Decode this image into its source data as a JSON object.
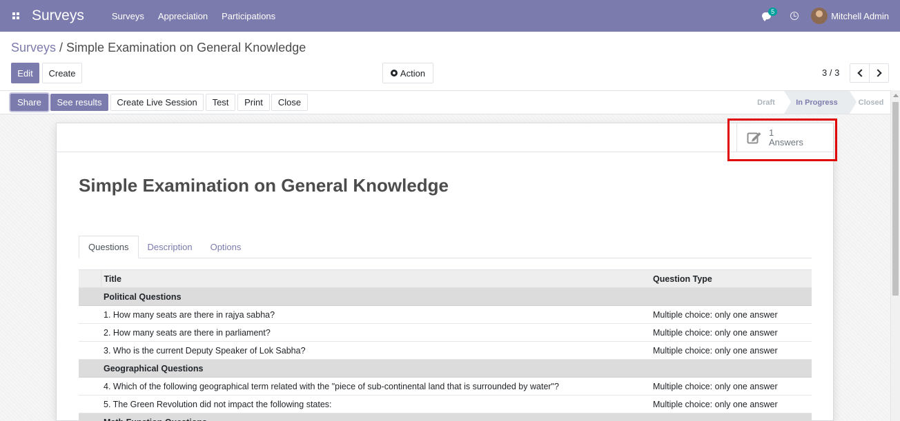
{
  "navbar": {
    "app_name": "Surveys",
    "menu": [
      "Surveys",
      "Appreciation",
      "Participations"
    ],
    "chat_count": "5",
    "user_name": "Mitchell Admin",
    "color": "#7c7bad"
  },
  "breadcrumb": {
    "parent": "Surveys",
    "separator": " / ",
    "current": "Simple Examination on General Knowledge"
  },
  "control_panel": {
    "edit_label": "Edit",
    "create_label": "Create",
    "action_label": "Action",
    "pager_value": "3 / 3"
  },
  "statusbar": {
    "buttons": [
      "Share",
      "See results",
      "Create Live Session",
      "Test",
      "Print",
      "Close"
    ],
    "stages": [
      "Draft",
      "In Progress",
      "Closed"
    ],
    "active_stage": "In Progress"
  },
  "sheet": {
    "stat_count": "1",
    "stat_label": "Answers",
    "title": "Simple Examination on General Knowledge",
    "tabs": [
      "Questions",
      "Description",
      "Options"
    ],
    "table": {
      "headers": [
        "Title",
        "Question Type"
      ],
      "rows": [
        {
          "kind": "section",
          "title": "Political Questions",
          "type": ""
        },
        {
          "kind": "question",
          "title": "1. How many seats are there in rajya sabha?",
          "type": "Multiple choice: only one answer"
        },
        {
          "kind": "question",
          "title": "2. How many seats are there in parliament?",
          "type": "Multiple choice: only one answer"
        },
        {
          "kind": "question",
          "title": "3. Who is the current Deputy Speaker of Lok Sabha?",
          "type": "Multiple choice: only one answer"
        },
        {
          "kind": "section",
          "title": "Geographical Questions",
          "type": ""
        },
        {
          "kind": "question",
          "title": "4. Which of the following geographical term related with the \"piece of sub-continental land that is surrounded by water\"?",
          "type": "Multiple choice: only one answer"
        },
        {
          "kind": "question",
          "title": "5. The Green Revolution did not impact the following states:",
          "type": "Multiple choice: only one answer"
        },
        {
          "kind": "section",
          "title": "Math Function Questions",
          "type": ""
        }
      ]
    }
  }
}
